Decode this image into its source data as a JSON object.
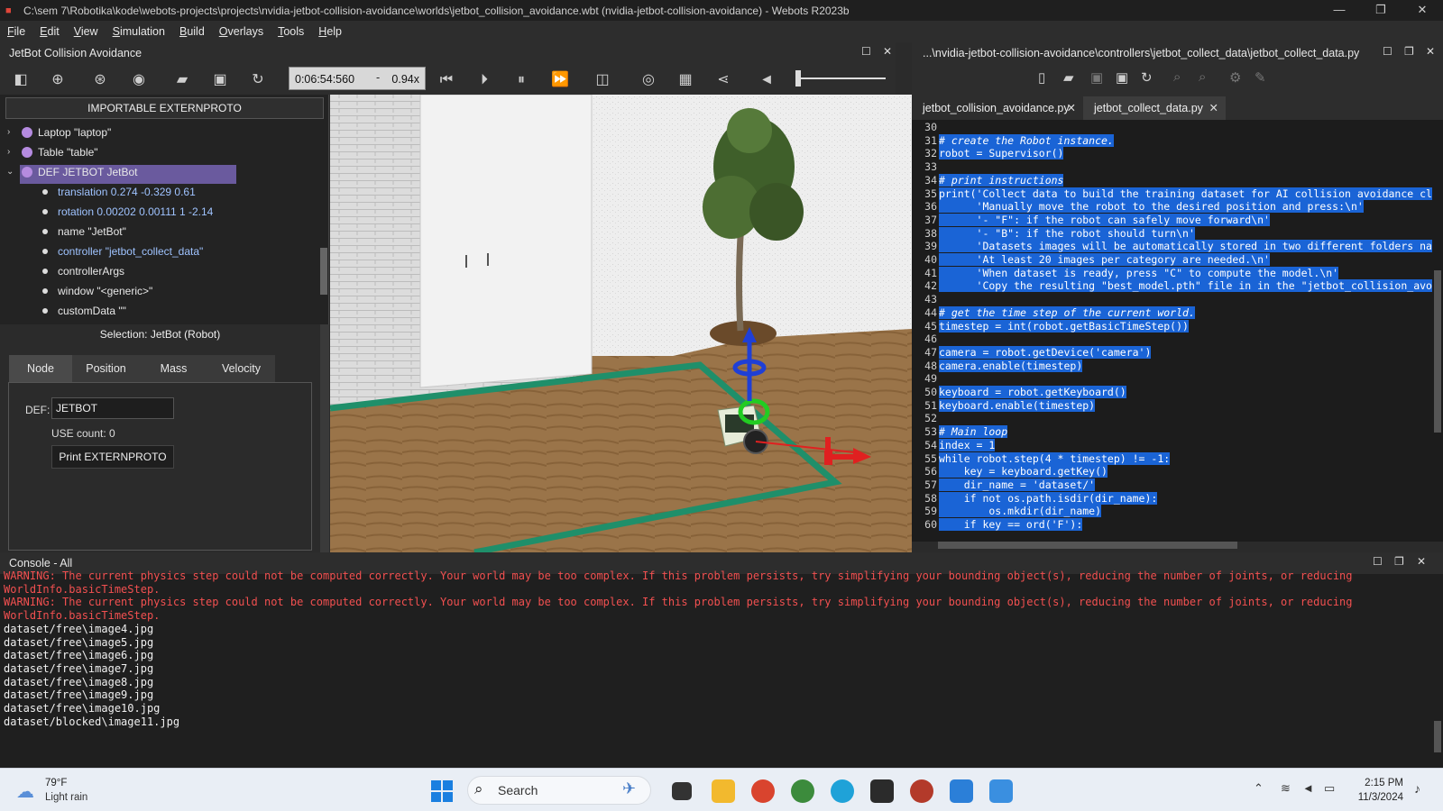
{
  "window": {
    "title": "C:\\sem 7\\Robotika\\kode\\webots-projects\\projects\\nvidia-jetbot-collision-avoidance\\worlds\\jetbot_collision_avoidance.wbt (nvidia-jetbot-collision-avoidance) - Webots R2023b"
  },
  "menu": [
    "File",
    "Edit",
    "View",
    "Simulation",
    "Build",
    "Overlays",
    "Tools",
    "Help"
  ],
  "left_panel": {
    "title": "JetBot Collision Avoidance",
    "time": "0:06:54:560",
    "dash": "-",
    "speed": "0.94x",
    "importable_button": "IMPORTABLE EXTERNPROTO",
    "tree": [
      {
        "label": "Laptop \"laptop\"",
        "kind": "node"
      },
      {
        "label": "Table \"table\"",
        "kind": "node"
      },
      {
        "label": "DEF JETBOT JetBot",
        "kind": "node-open"
      },
      {
        "label": "translation 0.274 -0.329 0.61",
        "kind": "field-link"
      },
      {
        "label": "rotation 0.00202 0.00111 1 -2.14",
        "kind": "field-link"
      },
      {
        "label": "name \"JetBot\"",
        "kind": "field"
      },
      {
        "label": "controller \"jetbot_collect_data\"",
        "kind": "field-link"
      },
      {
        "label": "controllerArgs",
        "kind": "field"
      },
      {
        "label": "window \"<generic>\"",
        "kind": "field"
      },
      {
        "label": "customData \"\"",
        "kind": "field"
      }
    ],
    "selection": "Selection: JetBot (Robot)",
    "tabs": [
      "Node",
      "Position",
      "Mass",
      "Velocity"
    ],
    "def_label": "DEF:",
    "def_value": "JETBOT",
    "use_count": "USE count: 0",
    "print_button": "Print EXTERNPROTO"
  },
  "editor": {
    "path": "...\\nvidia-jetbot-collision-avoidance\\controllers\\jetbot_collect_data\\jetbot_collect_data.py",
    "tabs": [
      "jetbot_collision_avoidance.py",
      "jetbot_collect_data.py"
    ],
    "tab_close": "✕",
    "lines": [
      {
        "n": "30",
        "t": "",
        "c": false
      },
      {
        "n": "31",
        "t": "# create the Robot instance.",
        "c": true
      },
      {
        "n": "32",
        "t": "robot = Supervisor()",
        "c": false
      },
      {
        "n": "33",
        "t": "",
        "c": false
      },
      {
        "n": "34",
        "t": "# print instructions",
        "c": true
      },
      {
        "n": "35",
        "t": "print('Collect data to build the training dataset for AI collision avoidance cl",
        "c": false
      },
      {
        "n": "36",
        "t": "      'Manually move the robot to the desired position and press:\\n'",
        "c": false
      },
      {
        "n": "37",
        "t": "      '- \"F\": if the robot can safely move forward\\n'",
        "c": false
      },
      {
        "n": "38",
        "t": "      '- \"B\": if the robot should turn\\n'",
        "c": false
      },
      {
        "n": "39",
        "t": "      'Datasets images will be automatically stored in two different folders na",
        "c": false
      },
      {
        "n": "40",
        "t": "      'At least 20 images per category are needed.\\n'",
        "c": false
      },
      {
        "n": "41",
        "t": "      'When dataset is ready, press \"C\" to compute the model.\\n'",
        "c": false
      },
      {
        "n": "42",
        "t": "      'Copy the resulting \"best_model.pth\" file in in the \"jetbot_collision_avo",
        "c": false
      },
      {
        "n": "43",
        "t": "",
        "c": false
      },
      {
        "n": "44",
        "t": "# get the time step of the current world.",
        "c": true
      },
      {
        "n": "45",
        "t": "timestep = int(robot.getBasicTimeStep())",
        "c": false
      },
      {
        "n": "46",
        "t": "",
        "c": false
      },
      {
        "n": "47",
        "t": "camera = robot.getDevice('camera')",
        "c": false
      },
      {
        "n": "48",
        "t": "camera.enable(timestep)",
        "c": false
      },
      {
        "n": "49",
        "t": "",
        "c": false
      },
      {
        "n": "50",
        "t": "keyboard = robot.getKeyboard()",
        "c": false
      },
      {
        "n": "51",
        "t": "keyboard.enable(timestep)",
        "c": false
      },
      {
        "n": "52",
        "t": "",
        "c": false
      },
      {
        "n": "53",
        "t": "# Main loop",
        "c": true
      },
      {
        "n": "54",
        "t": "index = 1",
        "c": false
      },
      {
        "n": "55",
        "t": "while robot.step(4 * timestep) != -1:",
        "c": false
      },
      {
        "n": "56",
        "t": "    key = keyboard.getKey()",
        "c": false
      },
      {
        "n": "57",
        "t": "    dir_name = 'dataset/'",
        "c": false
      },
      {
        "n": "58",
        "t": "    if not os.path.isdir(dir_name):",
        "c": false
      },
      {
        "n": "59",
        "t": "        os.mkdir(dir_name)",
        "c": false
      },
      {
        "n": "60",
        "t": "    if key == ord('F'):",
        "c": false
      }
    ]
  },
  "console": {
    "title": "Console - All",
    "lines": [
      {
        "t": "WARNING: The current physics step could not be computed correctly. Your world may be too complex. If this problem persists, try simplifying your bounding object(s), reducing the number of joints, or reducing",
        "w": true
      },
      {
        "t": "WorldInfo.basicTimeStep.",
        "w": true
      },
      {
        "t": "WARNING: The current physics step could not be computed correctly. Your world may be too complex. If this problem persists, try simplifying your bounding object(s), reducing the number of joints, or reducing",
        "w": true
      },
      {
        "t": "WorldInfo.basicTimeStep.",
        "w": true
      },
      {
        "t": "dataset/free\\image4.jpg",
        "w": false
      },
      {
        "t": "dataset/free\\image5.jpg",
        "w": false
      },
      {
        "t": "dataset/free\\image6.jpg",
        "w": false
      },
      {
        "t": "dataset/free\\image7.jpg",
        "w": false
      },
      {
        "t": "dataset/free\\image8.jpg",
        "w": false
      },
      {
        "t": "dataset/free\\image9.jpg",
        "w": false
      },
      {
        "t": "dataset/free\\image10.jpg",
        "w": false
      },
      {
        "t": "dataset/blocked\\image11.jpg",
        "w": false
      }
    ]
  },
  "taskbar": {
    "temp": "79°F",
    "weather": "Light rain",
    "search": "Search",
    "time": "2:15 PM",
    "date": "11/3/2024"
  },
  "colors": {
    "warning": "#f25050",
    "selection": "#1a64d6",
    "tree_selected": "#6a5a9e"
  }
}
